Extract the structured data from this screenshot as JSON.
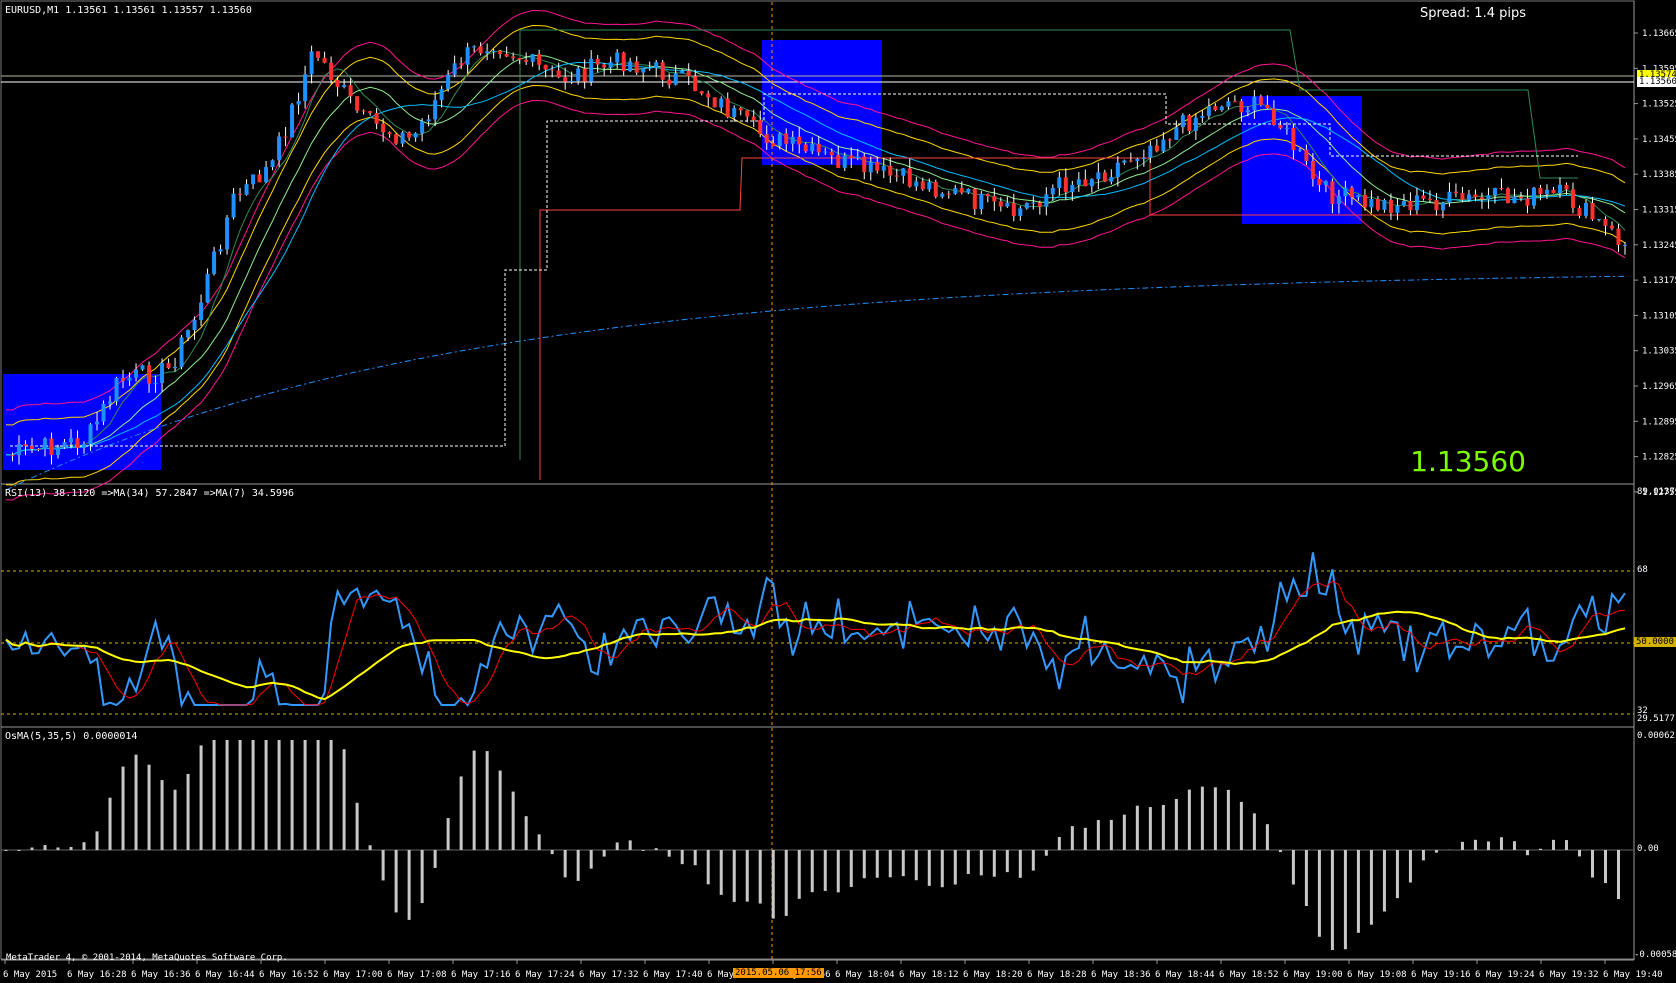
{
  "window": {
    "symbol_header": "EURUSD,M1  1.13561 1.13561 1.13557 1.13560",
    "spread_text": "Spread: 1.4 pips",
    "current_price_big": "1.13560",
    "copyright": "MetaTrader 4, © 2001-2014, MetaQuotes Software Corp."
  },
  "price_axis": {
    "labels": [
      "1.13665",
      "1.13595",
      "1.13525",
      "1.13455",
      "1.13385",
      "1.13315",
      "1.13245",
      "1.13175",
      "1.13105",
      "1.13035",
      "1.12965",
      "1.12895",
      "1.12825",
      "1.12755"
    ],
    "tags": [
      {
        "text": "1.13574",
        "color": "#ffff00"
      },
      {
        "text": "1.13560",
        "color": "#ffffff"
      }
    ]
  },
  "rsi_panel": {
    "title": "RSI(13) 38.1120  =>MA(34) 57.2847  =>MA(7) 34.5996",
    "axis_labels": [
      "89.0137",
      "68",
      "50.0000",
      "32",
      "29.5177"
    ]
  },
  "osma_panel": {
    "title": "OsMA(5,35,5) 0.0000014",
    "axis_labels": [
      "0.000621",
      "0.00",
      "-0.000587"
    ]
  },
  "time_axis": {
    "labels": [
      "6 May 2015",
      "6 May 16:28",
      "6 May 16:36",
      "6 May 16:44",
      "6 May 16:52",
      "6 May 17:00",
      "6 May 17:08",
      "6 May 17:16",
      "6 May 17:24",
      "6 May 17:32",
      "6 May 17:40",
      "6 May 17:48",
      "6 May 17:56",
      "6 May 18:04",
      "6 May 18:12",
      "6 May 18:20",
      "6 May 18:28",
      "6 May 18:36",
      "6 May 18:44",
      "6 May 18:52",
      "6 May 19:00",
      "6 May 19:08",
      "6 May 19:16",
      "6 May 19:24",
      "6 May 19:32",
      "6 May 19:40"
    ],
    "crosshair_label": "2015.05.06 17:56"
  },
  "colors": {
    "bull": "#1e90ff",
    "bear": "#ff3030",
    "box": "#0000ff",
    "rsi": "#3399ff",
    "rsi_ma_fast": "#ff0000",
    "rsi_ma_slow": "#ffff00",
    "osma": "#c8c8c8",
    "accent_green": "#7CFC00",
    "grid_dash": "#ffd700"
  }
}
